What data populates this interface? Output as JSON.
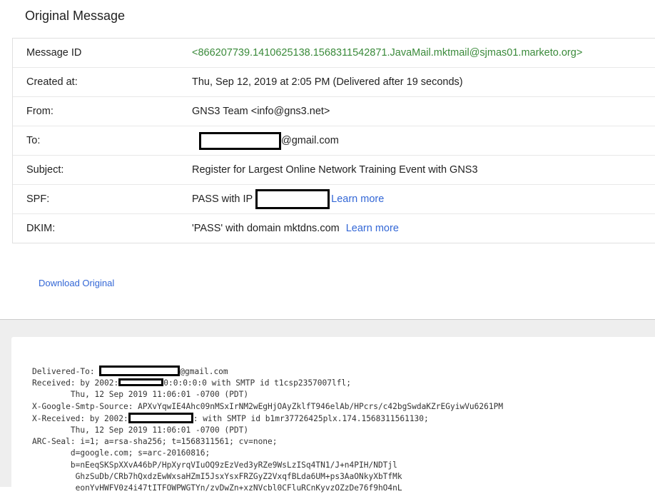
{
  "page": {
    "title": "Original Message"
  },
  "details": {
    "rows": [
      {
        "label": "Message ID",
        "value": "<866207739.1410625138.1568311542871.JavaMail.mktmail@sjmas01.marketo.org>"
      },
      {
        "label": "Created at:",
        "value": "Thu, Sep 12, 2019 at 2:05 PM (Delivered after 19 seconds)"
      },
      {
        "label": "From:",
        "value": "GNS3 Team <info@gns3.net>"
      },
      {
        "label": "To:",
        "value_suffix": "@gmail.com"
      },
      {
        "label": "Subject:",
        "value": "Register for Largest Online Network Training Event with GNS3"
      },
      {
        "label": "SPF:",
        "value_prefix": "PASS with IP",
        "link": "Learn more"
      },
      {
        "label": "DKIM:",
        "value": "'PASS' with domain mktdns.com",
        "link": "Learn more"
      }
    ]
  },
  "actions": {
    "download_label": "Download Original"
  },
  "raw": {
    "lines": {
      "l1a": "Delivered-To: ",
      "l1b": "@gmail.com",
      "l2a": "Received: by 2002:",
      "l2b": "0:0:0:0:0 with SMTP id t1csp2357007lfl;",
      "l3": "        Thu, 12 Sep 2019 11:06:01 -0700 (PDT)",
      "l4": "X-Google-Smtp-Source: APXvYqwIE4Ahc09nMSxIrNM2wEgHjOAyZklfT946elAb/HPcrs/c42bgSwdaKZrEGyiwVu6261PM",
      "l5a": "X-Received: by 2002:",
      "l5b": ": with SMTP id b1mr37726425plx.174.1568311561130;",
      "l6": "        Thu, 12 Sep 2019 11:06:01 -0700 (PDT)",
      "l7": "ARC-Seal: i=1; a=rsa-sha256; t=1568311561; cv=none;",
      "l8": "        d=google.com; s=arc-20160816;",
      "l9": "        b=nEeqSKSpXXvA46bP/HpXyrqVIuOQ9zEzVed3yRZe9WsLzISq4TN1/J+n4PIH/NDTjl",
      "l10": "         GhzSuDb/CRb7hQxdzEwWxsaHZmI5JsxYsxFRZGyZ2VxqfBLda6UM+ps3AaONkyXbTfMk",
      "l11": "         eonYvHWFV0z4i47tITFOWPWGTYn/zvDwZn+xzNVcbl0CFluRCnKyvzOZzDe76f9hO4nL"
    }
  }
}
